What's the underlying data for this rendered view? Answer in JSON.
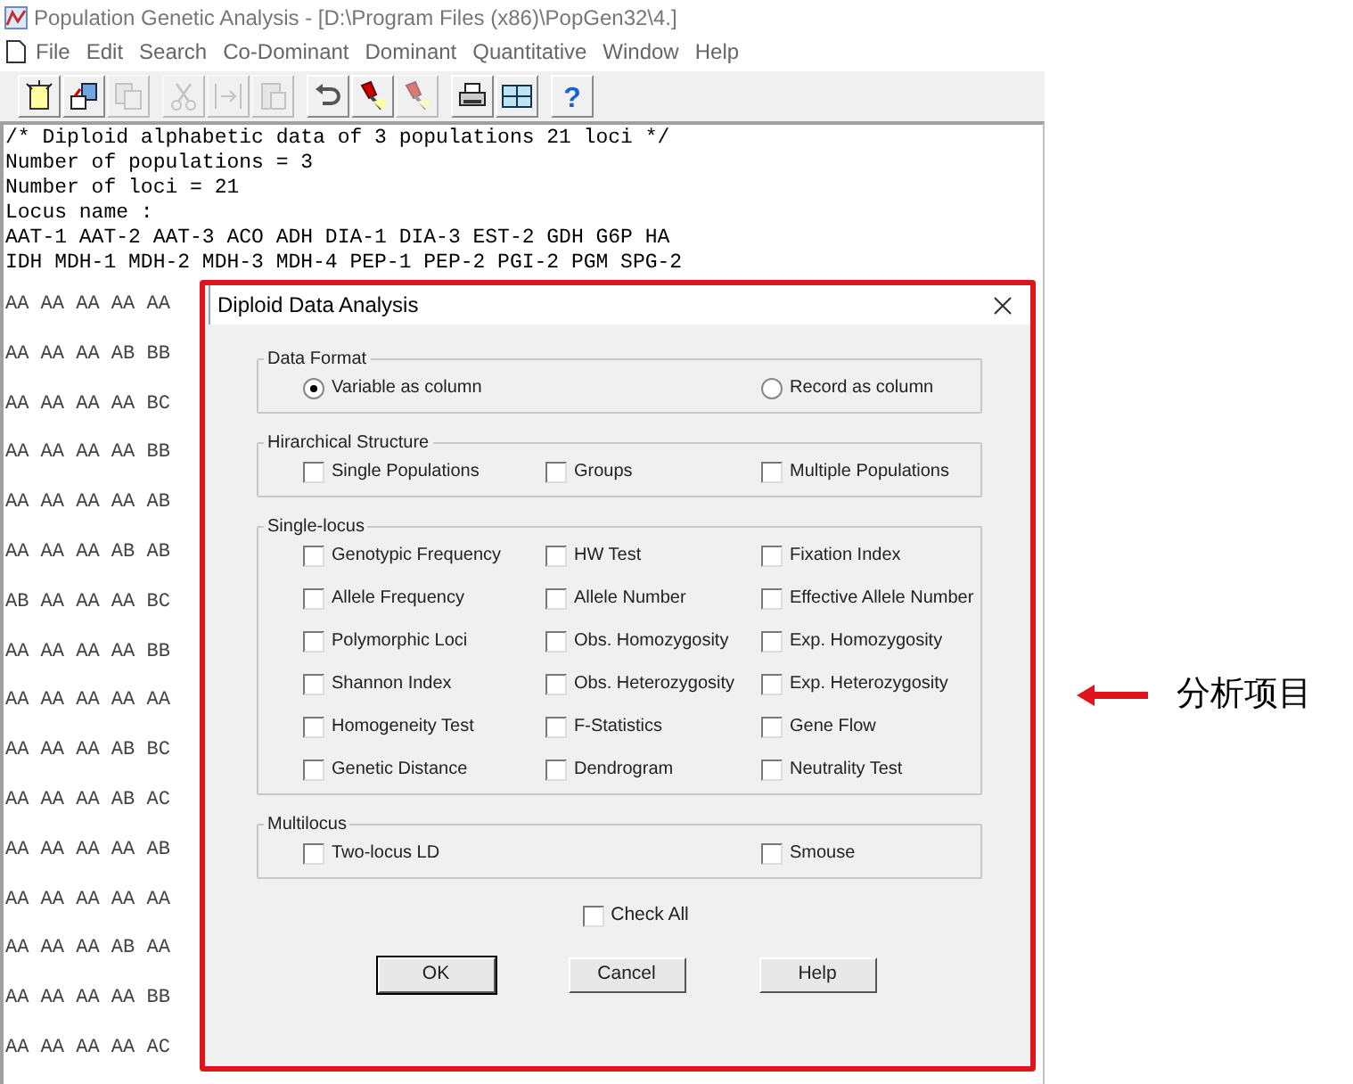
{
  "window": {
    "title": "Population Genetic Analysis - [D:\\Program Files (x86)\\PopGen32\\4.]"
  },
  "menu": [
    {
      "label": "File"
    },
    {
      "label": "Edit"
    },
    {
      "label": "Search"
    },
    {
      "label": "Co-Dominant"
    },
    {
      "label": "Dominant"
    },
    {
      "label": "Quantitative"
    },
    {
      "label": "Window"
    },
    {
      "label": "Help"
    }
  ],
  "toolbar": [
    {
      "kind": "new",
      "disabled": false
    },
    {
      "kind": "open",
      "disabled": false
    },
    {
      "kind": "save",
      "disabled": true
    },
    {
      "kind": "cut",
      "disabled": true
    },
    {
      "kind": "copy",
      "disabled": true
    },
    {
      "kind": "paste",
      "disabled": true
    },
    {
      "kind": "undo",
      "disabled": false
    },
    {
      "kind": "mark",
      "disabled": false
    },
    {
      "kind": "mark",
      "disabled": true
    },
    {
      "kind": "print",
      "disabled": false
    },
    {
      "kind": "grid",
      "disabled": false
    },
    {
      "kind": "help",
      "disabled": false,
      "glyph": "?"
    }
  ],
  "editor": {
    "header_lines": [
      "/* Diploid alphabetic data of 3 populations 21 loci */",
      "Number of populations = 3",
      "Number of loci = 21",
      "Locus name :",
      "AAT-1 AAT-2 AAT-3 ACO ADH DIA-1 DIA-3 EST-2 GDH G6P HA",
      "IDH MDH-1 MDH-2 MDH-3 MDH-4 PEP-1 PEP-2 PGI-2 PGM SPG-2"
    ],
    "data_rows": [
      "AA AA AA AA AA",
      "AA AA AA AB BB",
      "AA AA AA AA BC",
      "AA AA AA AA BB",
      "AA AA AA AA AB",
      "AA AA AA AB AB",
      "AB AA AA AA BC",
      "AA AA AA AA BB",
      "AA AA AA AA AA",
      "AA AA AA AB BC",
      "AA AA AA AB AC",
      "AA AA AA AA AB",
      "AA AA AA AA AA",
      "AA AA AA AB AA",
      "AA AA AA AA BB",
      "AA AA AA AA AC"
    ]
  },
  "dialog": {
    "title": "Diploid Data Analysis",
    "groups": [
      {
        "title": "Data Format",
        "kind": "radio",
        "options": [
          {
            "label": "Variable as column",
            "selected": true
          },
          {
            "label": "Record as column",
            "selected": false
          }
        ]
      },
      {
        "title": "Hirarchical Structure",
        "kind": "checkbox",
        "options": [
          {
            "label": "Single Populations",
            "checked": false
          },
          {
            "label": "Groups",
            "checked": false
          },
          {
            "label": "Multiple Populations",
            "checked": false
          }
        ]
      },
      {
        "title": "Single-locus",
        "kind": "checkbox",
        "options": [
          {
            "label": "Genotypic Frequency",
            "checked": false
          },
          {
            "label": "HW Test",
            "checked": false
          },
          {
            "label": "Fixation Index",
            "checked": false
          },
          {
            "label": "Allele Frequency",
            "checked": false
          },
          {
            "label": "Allele Number",
            "checked": false
          },
          {
            "label": "Effective Allele Number",
            "checked": false
          },
          {
            "label": "Polymorphic Loci",
            "checked": false
          },
          {
            "label": "Obs. Homozygosity",
            "checked": false
          },
          {
            "label": "Exp. Homozygosity",
            "checked": false
          },
          {
            "label": "Shannon Index",
            "checked": false
          },
          {
            "label": "Obs. Heterozygosity",
            "checked": false
          },
          {
            "label": "Exp. Heterozygosity",
            "checked": false
          },
          {
            "label": "Homogeneity Test",
            "checked": false
          },
          {
            "label": "F-Statistics",
            "checked": false
          },
          {
            "label": "Gene Flow",
            "checked": false
          },
          {
            "label": "Genetic Distance",
            "checked": false
          },
          {
            "label": "Dendrogram",
            "checked": false
          },
          {
            "label": "Neutrality Test",
            "checked": false
          }
        ]
      },
      {
        "title": "Multilocus",
        "kind": "checkbox",
        "options": [
          {
            "label": "Two-locus LD",
            "checked": false
          },
          {
            "label": "Smouse",
            "checked": false
          }
        ]
      }
    ],
    "check_all": {
      "label": "Check All",
      "checked": false
    },
    "buttons": [
      {
        "label": "OK",
        "default": true
      },
      {
        "label": "Cancel",
        "default": false
      },
      {
        "label": "Help",
        "default": false
      }
    ]
  },
  "annotation": {
    "label": "分析项目"
  }
}
